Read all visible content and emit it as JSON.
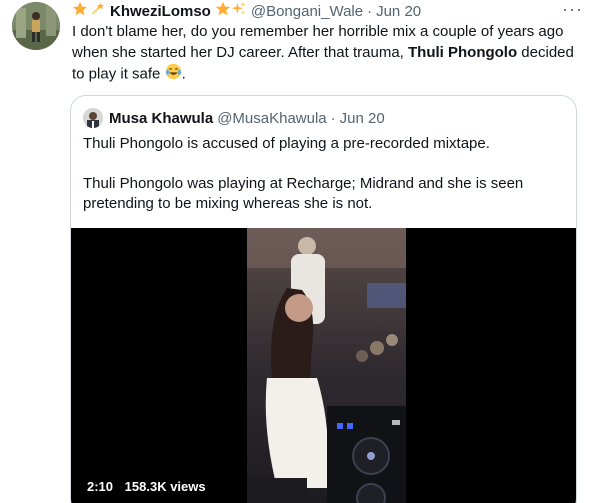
{
  "tweet": {
    "display_name": "KhweziLomso",
    "handle": "@Bongani_Wale",
    "separator": "·",
    "date": "Jun 20",
    "more_label": "···",
    "text_before_bold": "I don't blame her, do you remember her horrible mix a couple of years ago when she started her DJ career. After that trauma, ",
    "text_bold": "Thuli Phongolo",
    "text_after_bold": " decided to play it safe ",
    "text_end": ".",
    "name_prefix_emojis": [
      "star-icon",
      "dizzy-icon"
    ],
    "name_suffix_emojis": [
      "star-icon",
      "sparkles-icon"
    ],
    "text_emoji": "laughing-tears-icon"
  },
  "quoted_tweet": {
    "display_name": "Musa Khawula",
    "handle": "@MusaKhawula",
    "separator": "·",
    "date": "Jun 20",
    "paragraph_1": "Thuli Phongolo is accused of playing a pre-recorded mixtape.",
    "paragraph_2": "Thuli Phongolo was playing at Recharge; Midrand and she is seen pretending to be mixing whereas she is not.",
    "video": {
      "duration": "2:10",
      "views": "158.3K views"
    }
  },
  "colors": {
    "text_primary": "#0f1419",
    "text_secondary": "#536471",
    "border": "#cfd9de",
    "video_bg": "#000000"
  }
}
